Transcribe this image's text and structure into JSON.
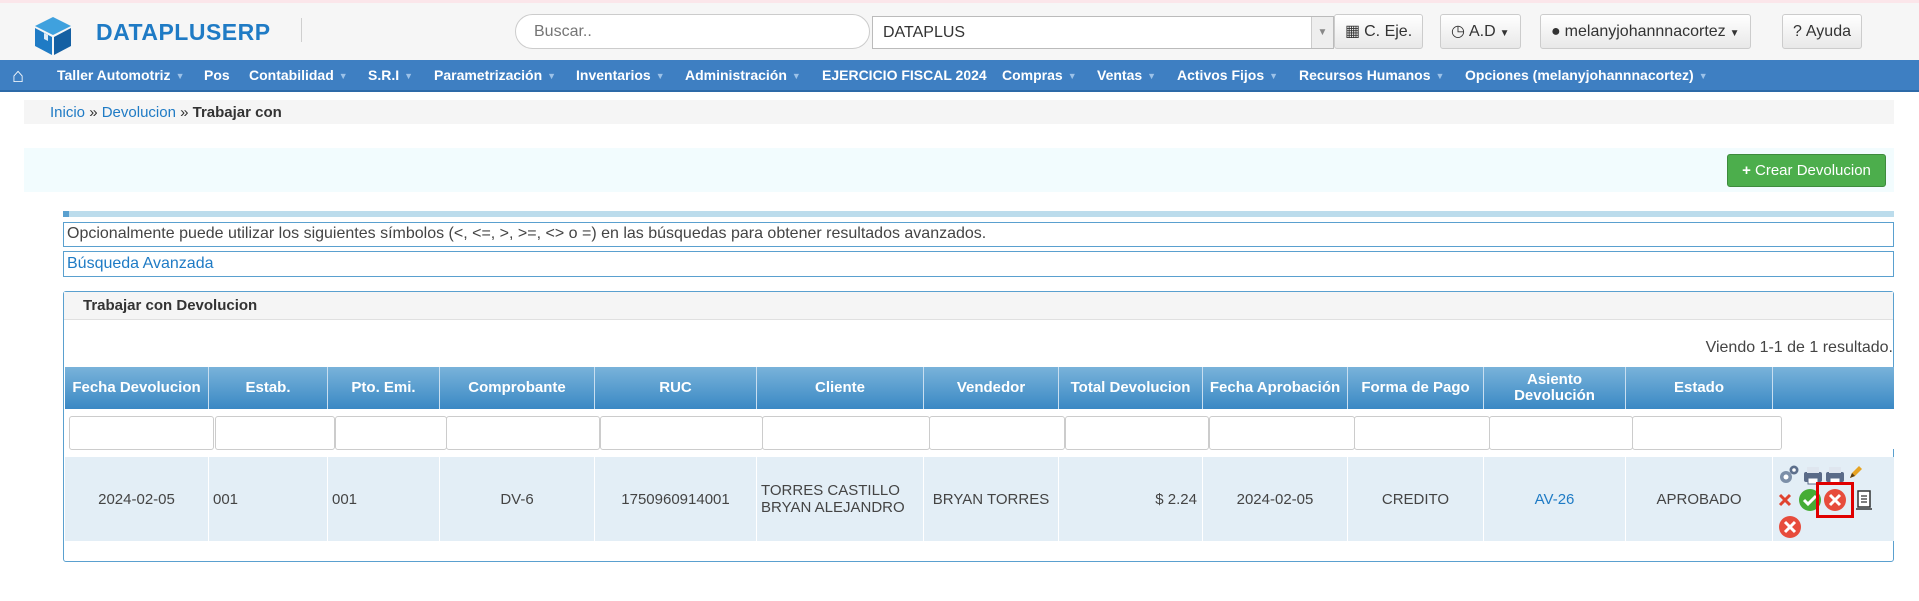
{
  "header": {
    "brand": "DATAPLUSERP",
    "search_placeholder": "Buscar..",
    "company_value": "DATAPLUS",
    "buttons": {
      "ejercicio": "C. Eje.",
      "ad": "A.D",
      "user": "melanyjohannnacortez",
      "help": "Ayuda"
    }
  },
  "nav": {
    "items": [
      "Taller Automotriz",
      "Pos",
      "Contabilidad",
      "S.R.I",
      "Parametrización",
      "Inventarios",
      "Administración",
      "EJERCICIO FISCAL 2024",
      "Compras",
      "Ventas",
      "Activos Fijos",
      "Recursos Humanos",
      "Opciones (melanyjohannnacortez)"
    ]
  },
  "breadcrumb": {
    "home": "Inicio",
    "sep1": "»",
    "section": "Devolucion",
    "sep2": "»",
    "current": "Trabajar con"
  },
  "actions": {
    "create": "Crear Devolucion"
  },
  "info_text": "Opcionalmente puede utilizar los siguientes símbolos (<, <=, >, >=, <> o =) en las búsquedas para obtener resultados avanzados.",
  "advanced_search": "Búsqueda Avanzada",
  "grid": {
    "title": "Trabajar con Devolucion",
    "summary": "Viendo 1-1 de 1 resultado.",
    "headers": [
      "Fecha Devolucion",
      "Estab.",
      "Pto. Emi.",
      "Comprobante",
      "RUC",
      "Cliente",
      "Vendedor",
      "Total Devolucion",
      "Fecha Aprobación",
      "Forma de Pago",
      "Asiento Devolución",
      ""
    ],
    "estado_header": "Estado",
    "rows": [
      {
        "fecha": "2024-02-05",
        "estab": "001",
        "pto": "001",
        "comprobante": "DV-6",
        "ruc": "1750960914001",
        "cliente_1": "TORRES CASTILLO",
        "cliente_2": "BRYAN ALEJANDRO",
        "vendedor": "BRYAN TORRES",
        "total": "$ 2.24",
        "fecha_aprobacion": "2024-02-05",
        "forma_pago": "CREDITO",
        "asiento": "AV-26",
        "estado": "APROBADO"
      }
    ]
  },
  "colors": {
    "brand": "#1f7bc5",
    "nav": "#3e7fc2",
    "success": "#4cae4c",
    "danger": "#e74c3c",
    "highlight": "#e00000"
  }
}
